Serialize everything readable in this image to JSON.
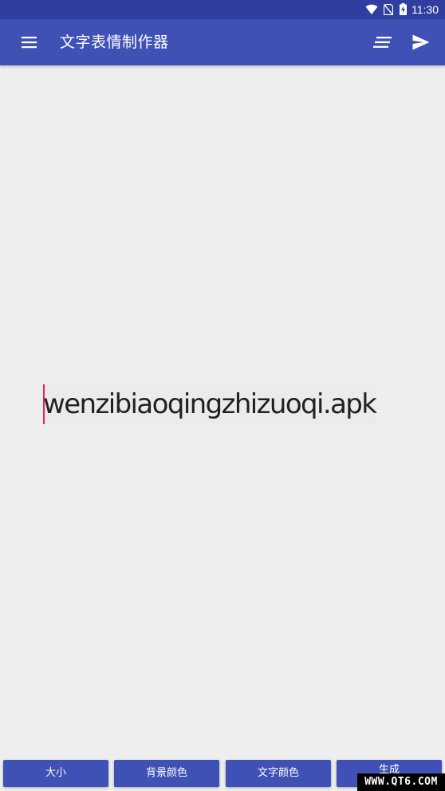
{
  "status_bar": {
    "time": "11:30",
    "icons": [
      "wifi-icon",
      "no-sim-icon",
      "battery-charging-icon"
    ],
    "color": "#303f9f"
  },
  "toolbar": {
    "title": "文字表情制作器",
    "left_icon": "menu-icon",
    "right_icons": [
      "text-align-icon",
      "send-icon"
    ],
    "color": "#3f51b5"
  },
  "editor": {
    "value": "wenzibiaoqingzhizuoqi.apk",
    "cursor_color": "#e91e63"
  },
  "bottom_buttons": {
    "size": "大小",
    "background_color": "背景颜色",
    "text_color": "文字颜色",
    "generate": "生成"
  },
  "watermark": {
    "text": "WWW.QT6.COM"
  }
}
